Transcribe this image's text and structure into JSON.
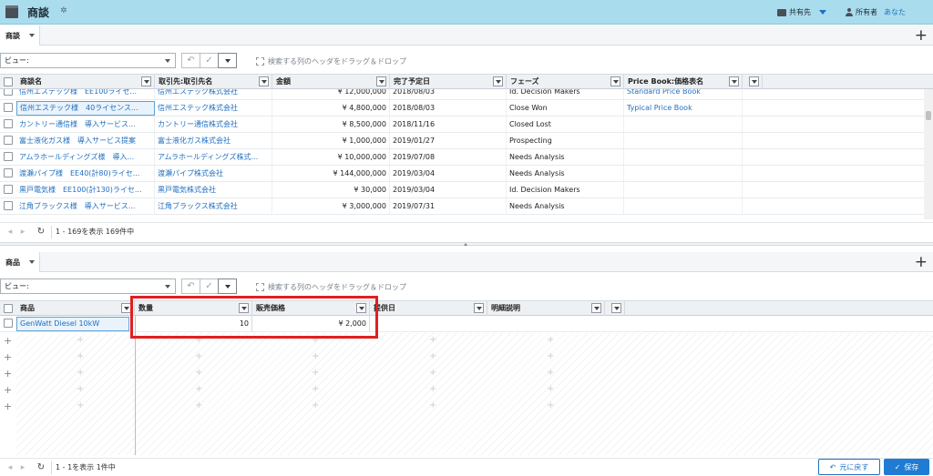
{
  "header": {
    "title": "商談",
    "share_label": "共有先",
    "owner_label": "所有者",
    "owner_name": "あなた"
  },
  "top": {
    "tab_label": "商談",
    "view_label": "ビュー:",
    "drag_hint": "検索する列のヘッダをドラッグ＆ドロップ",
    "columns": [
      "商談名",
      "取引先:取引先名",
      "金額",
      "完了予定日",
      "フェーズ",
      "Price Book:価格表名"
    ],
    "rows": [
      [
        "信州エステック様　EE100ライセ...",
        "信州エステック株式会社",
        "¥ 12,000,000",
        "2018/08/03",
        "Id. Decision Makers",
        "Standard Price Book"
      ],
      [
        "信州エステック様　40ライセンス...",
        "信州エステック株式会社",
        "¥ 4,800,000",
        "2018/08/03",
        "Close Won",
        "Typical Price Book"
      ],
      [
        "カントリー通信様　導入サービス...",
        "カントリー通信株式会社",
        "¥ 8,500,000",
        "2018/11/16",
        "Closed Lost",
        ""
      ],
      [
        "富士液化ガス様　導入サービス提案",
        "富士液化ガス株式会社",
        "¥ 1,000,000",
        "2019/01/27",
        "Prospecting",
        ""
      ],
      [
        "アムラホールディングズ様　導入...",
        "アムラホールディングズ株式...",
        "¥ 10,000,000",
        "2019/07/08",
        "Needs Analysis",
        ""
      ],
      [
        "渡瀬パイプ様　EE40(計80)ライセ...",
        "渡瀬パイプ株式会社",
        "¥ 144,000,000",
        "2019/03/04",
        "Needs Analysis",
        ""
      ],
      [
        "黒戸電気様　EE100(計130)ライセ...",
        "黒戸電気株式会社",
        "¥ 30,000",
        "2019/03/04",
        "Id. Decision Makers",
        ""
      ],
      [
        "江角ブラックス様　導入サービス...",
        "江角ブラックス株式会社",
        "¥ 3,000,000",
        "2019/07/31",
        "Needs Analysis",
        ""
      ]
    ],
    "pager_text": "1 - 169を表示 169件中"
  },
  "bottom": {
    "tab_label": "商品",
    "view_label": "ビュー:",
    "drag_hint": "検索する列のヘッダをドラッグ＆ドロップ",
    "columns": [
      "商品",
      "数量",
      "販売価格",
      "提供日",
      "明細説明"
    ],
    "row": {
      "product": "GenWatt Diesel 10kW",
      "quantity": "10",
      "price": "¥ 2,000"
    },
    "pager_text": "1 - 1を表示 1件中"
  },
  "actions": {
    "undo_label": "元に戻す",
    "save_label": "保存"
  },
  "colors": {
    "header_bg": "#a9dced",
    "link": "#1f6fc2",
    "highlight": "#e02020",
    "save_bg": "#1f7bd3"
  }
}
